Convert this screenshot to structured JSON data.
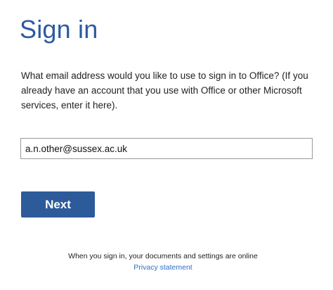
{
  "signin": {
    "title": "Sign in",
    "description": "What email address would you like to use to sign in to Office? (If you already have an account that you use with Office or other Microsoft services, enter it here).",
    "email_value": "a.n.other@sussex.ac.uk",
    "next_label": "Next"
  },
  "footer": {
    "notice": "When you sign in, your documents and settings are online",
    "privacy_link": "Privacy statement"
  },
  "colors": {
    "title": "#2c5aa0",
    "button": "#2d5b9a",
    "link": "#2c6fc9"
  }
}
